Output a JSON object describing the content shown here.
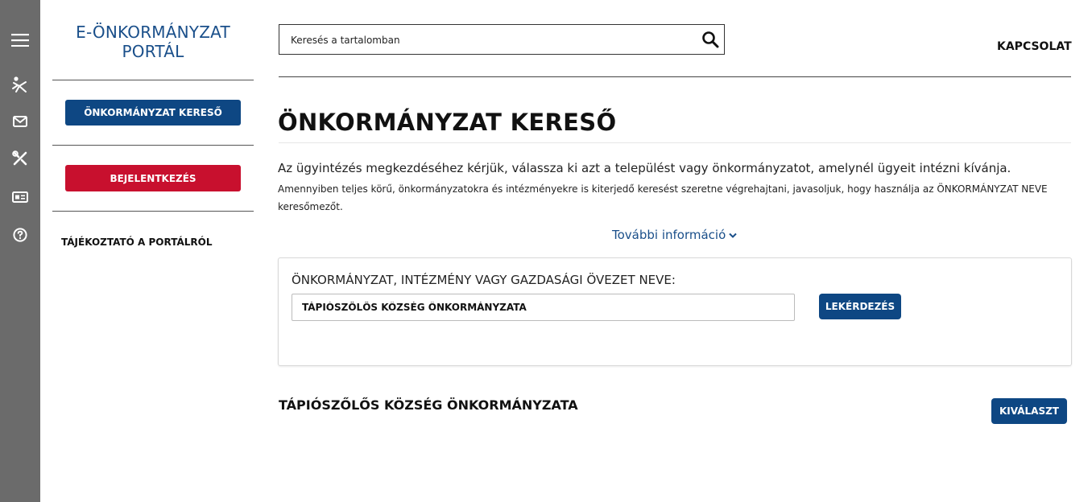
{
  "sidebar": {
    "logo": "E-ÖNKORMÁNYZAT PORTÁL",
    "finder_button": "ÖNKORMÁNYZAT KERESŐ",
    "login_button": "BEJELENTKEZÉS",
    "info_link": "TÁJÉKOZTATÓ A PORTÁLRÓL"
  },
  "rail": {
    "icons": [
      "menu-icon",
      "person-accessibility-icon",
      "envelope-icon",
      "tools-icon",
      "id-card-icon",
      "help-circle-icon"
    ]
  },
  "header": {
    "search_placeholder": "Keresés a tartalomban",
    "contact": "KAPCSOLAT"
  },
  "main": {
    "title": "ÖNKORMÁNYZAT KERESŐ",
    "lead": "Az ügyintézés megkezdéséhez kérjük, válassza ki azt a települést vagy önkormányzatot, amelynél ügyeit intézni kívánja.",
    "lead_small": "Amennyiben teljes körű, önkormányzatokra és intézményekre is kiterjedő keresést szeretne végrehajtani, javasoljuk, hogy használja az ÖNKORMÁNYZAT NEVE keresőmezőt.",
    "more_info": "További információ"
  },
  "search_panel": {
    "label": "ÖNKORMÁNYZAT, INTÉZMÉNY VAGY GAZDASÁGI ÖVEZET NEVE:",
    "value": "TÁPIÓSZŐLŐS KÖZSÉG ÖNKORMÁNYZATA",
    "query_button": "LEKÉRDEZÉS"
  },
  "results": [
    {
      "name": "TÁPIÓSZŐLŐS KÖZSÉG ÖNKORMÁNYZATA",
      "select_button": "KIVÁLASZT"
    }
  ],
  "colors": {
    "rail": "#6b6b6b",
    "brand_blue": "#0e4783",
    "login_red": "#c8102e",
    "link_blue": "#1a4f8a"
  }
}
